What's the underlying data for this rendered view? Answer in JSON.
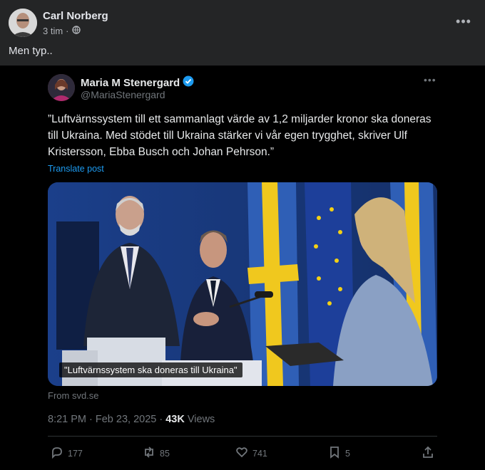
{
  "post": {
    "author": "Carl Norberg",
    "time": "3 tim",
    "separator": "·",
    "text": "Men typ.."
  },
  "tweet": {
    "name": "Maria M Stenergard",
    "handle": "@MariaStenergard",
    "text": "”Luftvärnssystem till ett sammanlagt värde av 1,2 miljarder kronor ska doneras till Ukraina. Med stödet till Ukraina stärker vi vår egen trygghet, skriver Ulf Kristersson, Ebba Busch och Johan Pehrson.”",
    "translate": "Translate post",
    "media_caption": "\"Luftvärnssystem ska doneras till Ukraina\"",
    "from": "From svd.se",
    "time": "8:21 PM · Feb 23, 2025 · ",
    "views_count": "43K",
    "views_label": " Views",
    "replies": "177",
    "reposts": "85",
    "likes": "741",
    "bookmarks": "5"
  },
  "colors": {
    "facebook_bg": "#242526",
    "x_bg": "#000000",
    "link_blue": "#1d9bf0",
    "verified_blue": "#1d9bf0"
  },
  "icons": [
    "globe-icon",
    "more-icon",
    "verified-icon",
    "reply-icon",
    "repost-icon",
    "like-icon",
    "bookmark-icon",
    "share-icon"
  ]
}
